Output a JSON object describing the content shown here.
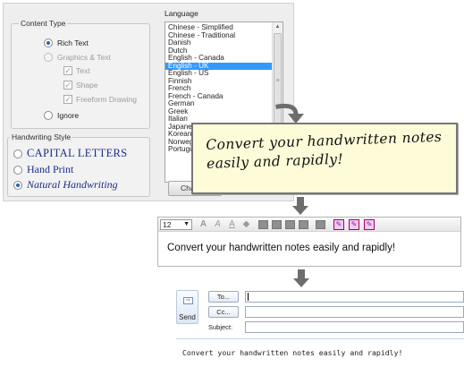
{
  "settings": {
    "content_type": {
      "label": "Content Type",
      "options": {
        "rich_text": "Rich Text",
        "graphics_text": "Graphics & Text",
        "text": "Text",
        "shape": "Shape",
        "freeform": "Freeform Drawing",
        "ignore": "Ignore"
      },
      "selected": "Rich Text"
    },
    "language": {
      "label": "Language",
      "items": [
        "Chinese - Simplified",
        "Chinese - Traditional",
        "Danish",
        "Dutch",
        "English - Canada",
        "English - UK",
        "English - US",
        "Finnish",
        "French",
        "French - Canada",
        "German",
        "Greek",
        "Italian",
        "Japanese",
        "Korean",
        "Norwegian",
        "Portuguese"
      ],
      "selected": "English - UK"
    },
    "change_button_label": "Cha",
    "handwriting_style": {
      "label": "Handwriting Style",
      "options": [
        "CAPITAL LETTERS",
        "Hand Print",
        "Natural Handwriting"
      ],
      "selected": "Natural Handwriting"
    }
  },
  "note": {
    "line1": "Convert your handwritten notes",
    "line2": "easily and rapidly!"
  },
  "editor": {
    "font_size": "12",
    "text": "Convert your handwritten notes easily and rapidly!"
  },
  "email": {
    "send_label": "Send",
    "to_label": "To...",
    "cc_label": "Cc...",
    "subject_label": "Subject:",
    "to_value": "",
    "cc_value": "",
    "subject_value": "",
    "body": "Convert your handwritten notes easily and rapidly!"
  },
  "colors": {
    "selection": "#3399ff",
    "note_background": "#fdfbd8",
    "handwriting_ink": "#1a2d8a"
  }
}
